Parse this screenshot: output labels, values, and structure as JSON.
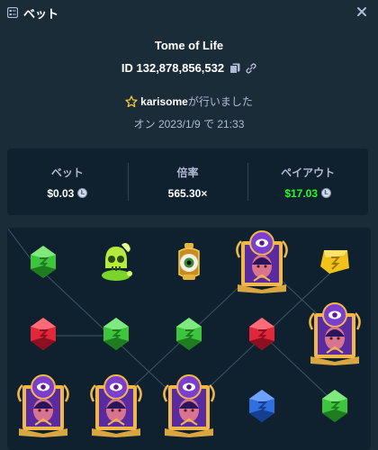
{
  "header": {
    "title": "ベット"
  },
  "game": {
    "title": "Tome of Life"
  },
  "bet": {
    "id_text": "ID 132,878,856,532"
  },
  "user": {
    "name": "karisome",
    "suffix": "が行いました"
  },
  "date": {
    "text": "オン 2023/1/9 で 21:33"
  },
  "stats": [
    {
      "label": "ベット",
      "value": "$0.03",
      "coin": true
    },
    {
      "label": "倍率",
      "value": "565.30×",
      "coin": false
    },
    {
      "label": "ペイアウト",
      "value": "$17.03",
      "coin": true
    }
  ],
  "coin_symbol": "Ł",
  "colors": {
    "background": "#1a2c38",
    "panel": "#0f212e",
    "muted_text": "#b1bad3",
    "payout_green": "#1fff20"
  },
  "reels": [
    [
      "green-gem",
      "red-gem",
      "book-of-life"
    ],
    [
      "poison-skull",
      "green-gem",
      "book-of-life"
    ],
    [
      "eye-lantern",
      "green-gem",
      "book-of-life"
    ],
    [
      "book-of-life",
      "red-gem",
      "blue-gem"
    ],
    [
      "yellow-gem",
      "book-of-life",
      "green-gem"
    ]
  ]
}
